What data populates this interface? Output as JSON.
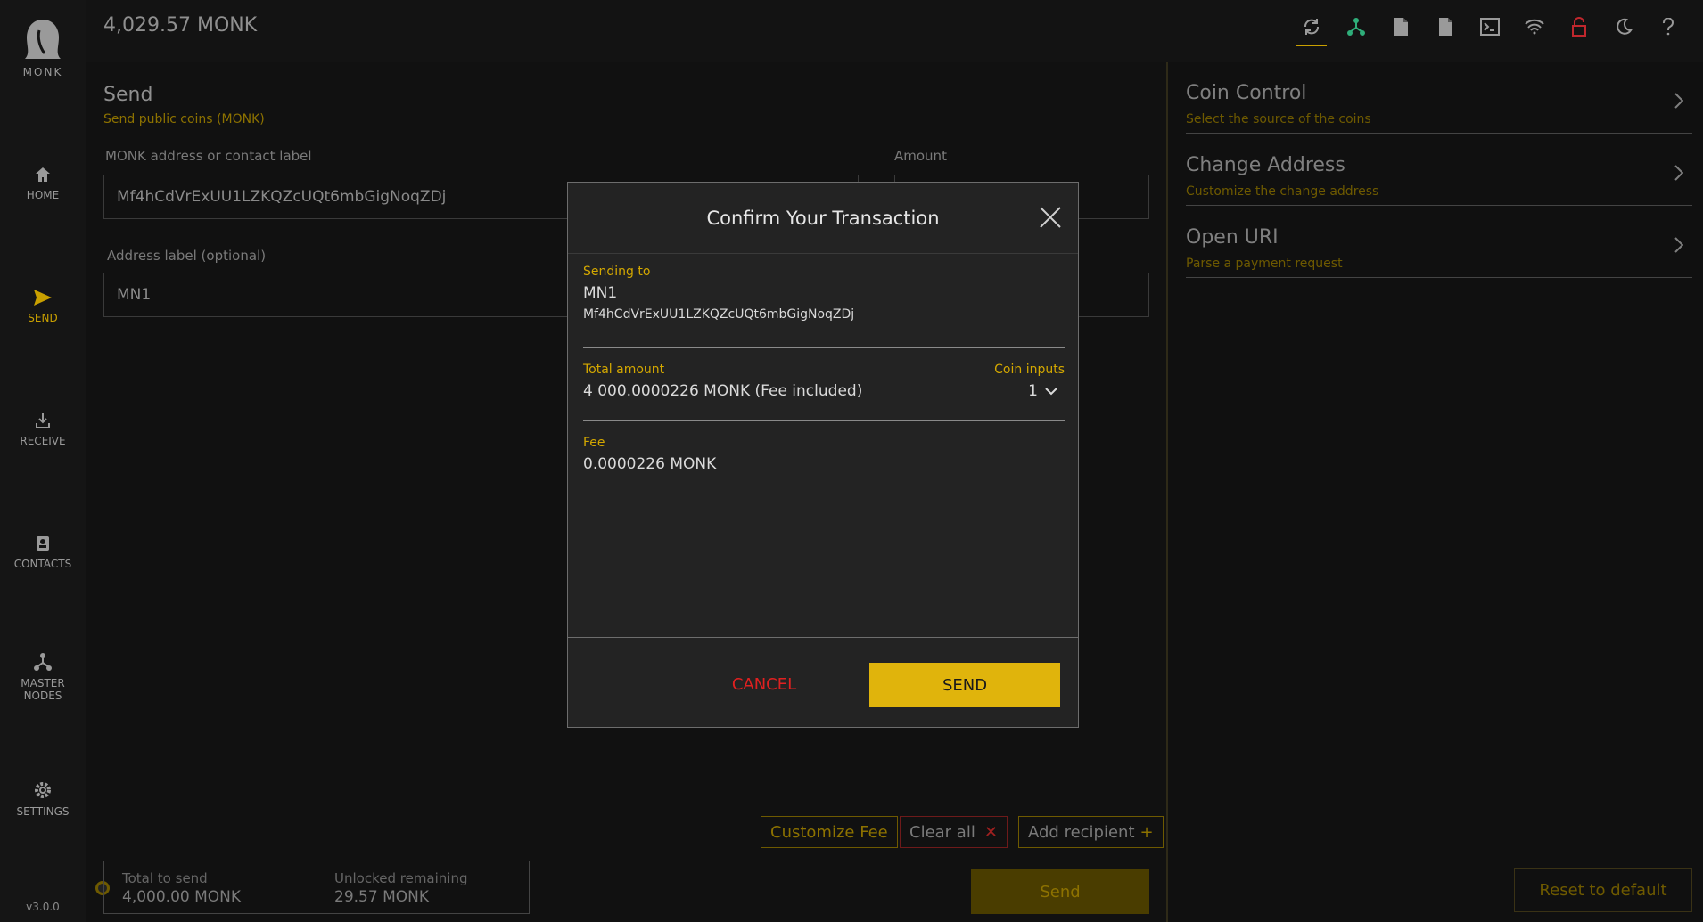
{
  "app": {
    "logo_text": "MONK",
    "version": "v3.0.0"
  },
  "header": {
    "balance": "4,029.57 MONK"
  },
  "sidebar": {
    "items": [
      {
        "label": "HOME",
        "icon": "home-icon"
      },
      {
        "label": "SEND",
        "icon": "send-icon",
        "active": true
      },
      {
        "label": "RECEIVE",
        "icon": "download-icon"
      },
      {
        "label": "CONTACTS",
        "icon": "contacts-icon"
      },
      {
        "label_line1": "MASTER",
        "label_line2": "NODES",
        "icon": "masternodes-icon"
      },
      {
        "label": "SETTINGS",
        "icon": "gear-icon"
      }
    ]
  },
  "send": {
    "title": "Send",
    "subtitle": "Send public coins (MONK)",
    "address_label": "MONK address or contact label",
    "address_value": "Mf4hCdVrExUU1LZKQZcUQt6mbGigNoqZDj",
    "amount_label": "Amount",
    "addr_label_label": "Address label (optional)",
    "addr_label_value": "MN1",
    "customize_fee": "Customize Fee",
    "clear_all": "Clear all",
    "add_recipient": "Add recipient",
    "total_to_send_label": "Total to send",
    "total_to_send_value": "4,000.00 MONK",
    "unlocked_label": "Unlocked remaining",
    "unlocked_value": "29.57 MONK",
    "send_button": "Send"
  },
  "right_panel": {
    "items": [
      {
        "title": "Coin Control",
        "subtitle": "Select the source of the coins"
      },
      {
        "title": "Change Address",
        "subtitle": "Customize the change address"
      },
      {
        "title": "Open URI",
        "subtitle": "Parse a payment request"
      }
    ],
    "reset": "Reset to default"
  },
  "modal": {
    "title": "Confirm Your Transaction",
    "sending_to_label": "Sending to",
    "recipient_label": "MN1",
    "recipient_address": "Mf4hCdVrExUU1LZKQZcUQt6mbGigNoqZDj",
    "total_amount_label": "Total amount",
    "total_amount_value": "4 000.0000226 MONK (Fee included)",
    "coin_inputs_label": "Coin inputs",
    "coin_inputs_value": "1",
    "fee_label": "Fee",
    "fee_value": "0.0000226 MONK",
    "cancel": "CANCEL",
    "send": "SEND"
  },
  "colors": {
    "accent": "#e0b40c",
    "danger": "#e02020"
  }
}
